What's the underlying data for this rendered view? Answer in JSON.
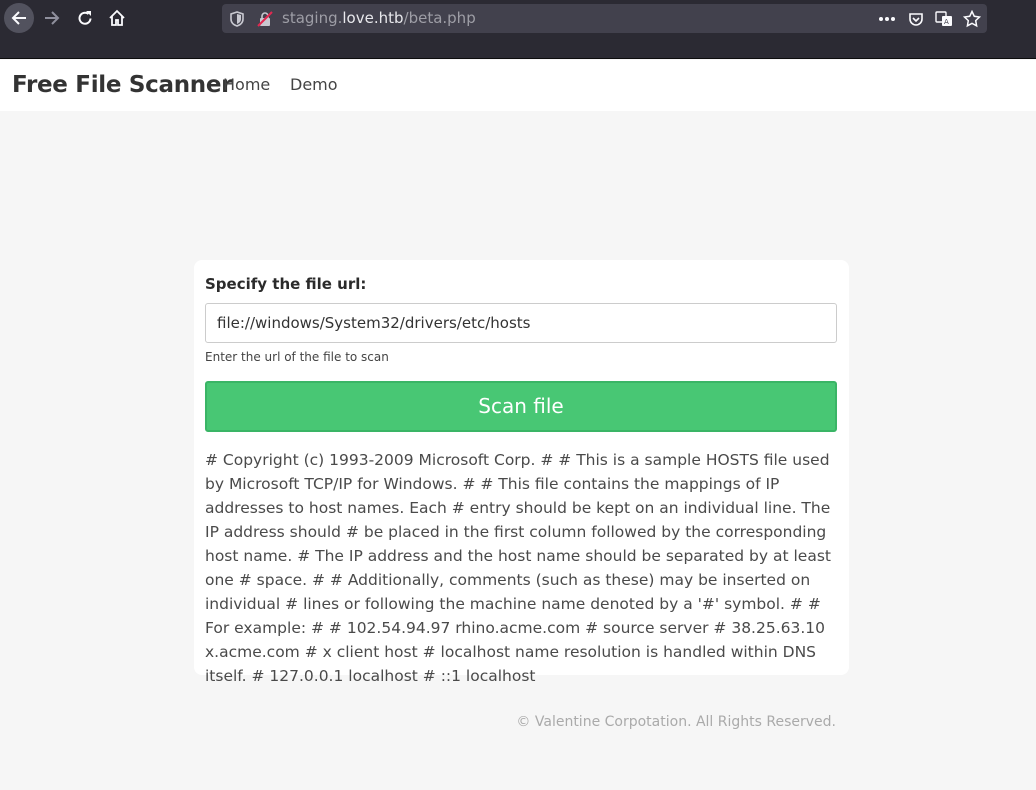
{
  "browser": {
    "url_host_prefix": "staging.",
    "url_host": "love.htb",
    "url_path": "/beta.php",
    "icons": [
      "back-icon",
      "forward-icon",
      "reload-icon",
      "home-icon",
      "shield-icon",
      "insecure-lock-icon",
      "more-icon",
      "pocket-icon",
      "translate-icon",
      "bookmark-star-icon"
    ]
  },
  "header": {
    "brand": "Free File Scanner",
    "nav": {
      "home": "Home",
      "demo": "Demo"
    }
  },
  "form": {
    "label": "Specify the file url:",
    "url_value": "file://windows/System32/drivers/etc/hosts",
    "helper": "Enter the url of the file to scan",
    "button": "Scan file"
  },
  "result": "# Copyright (c) 1993-2009 Microsoft Corp. # # This is a sample HOSTS file used by Microsoft TCP/IP for Windows. # # This file contains the mappings of IP addresses to host names. Each # entry should be kept on an individual line. The IP address should # be placed in the first column followed by the corresponding host name. # The IP address and the host name should be separated by at least one # space. # # Additionally, comments (such as these) may be inserted on individual # lines or following the machine name denoted by a '#' symbol. # # For example: # # 102.54.94.97 rhino.acme.com # source server # 38.25.63.10 x.acme.com # x client host # localhost name resolution is handled within DNS itself. # 127.0.0.1 localhost # ::1 localhost",
  "footer": "© Valentine Corpotation. All Rights Reserved.",
  "colors": {
    "button": "#48c774",
    "chrome": "#2b2a33",
    "urlbar": "#42414d"
  }
}
